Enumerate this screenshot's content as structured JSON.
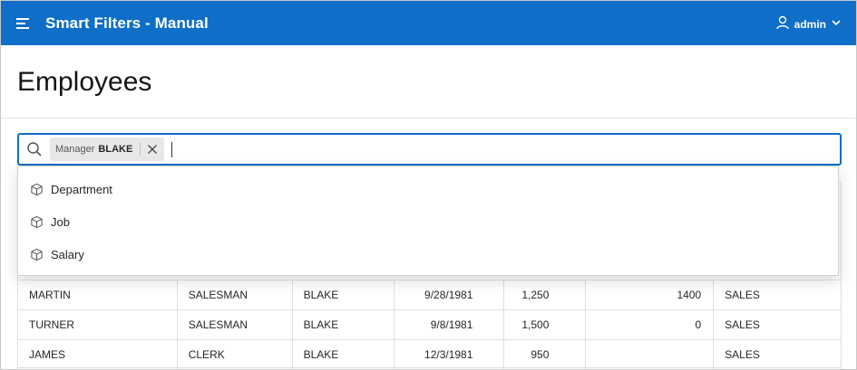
{
  "header": {
    "app_title": "Smart Filters - Manual",
    "user_name": "admin",
    "menu_icon": "hamburger-icon",
    "user_icon": "user-icon",
    "chevron_icon": "chevron-down-icon",
    "accent_color": "#0e6ec8"
  },
  "page": {
    "title": "Employees"
  },
  "search": {
    "placeholder": "",
    "value": "",
    "chips": [
      {
        "label": "Manager",
        "value": "BLAKE"
      }
    ]
  },
  "suggestions": [
    {
      "label": "Department",
      "icon": "cube-icon"
    },
    {
      "label": "Job",
      "icon": "cube-icon"
    },
    {
      "label": "Salary",
      "icon": "cube-icon"
    }
  ],
  "table": {
    "rows": [
      {
        "name": "MARTIN",
        "job": "SALESMAN",
        "manager": "BLAKE",
        "hired": "9/28/1981",
        "salary": "1,250",
        "commission": "1400",
        "department": "SALES"
      },
      {
        "name": "TURNER",
        "job": "SALESMAN",
        "manager": "BLAKE",
        "hired": "9/8/1981",
        "salary": "1,500",
        "commission": "0",
        "department": "SALES"
      },
      {
        "name": "JAMES",
        "job": "CLERK",
        "manager": "BLAKE",
        "hired": "12/3/1981",
        "salary": "950",
        "commission": "",
        "department": "SALES"
      }
    ]
  }
}
